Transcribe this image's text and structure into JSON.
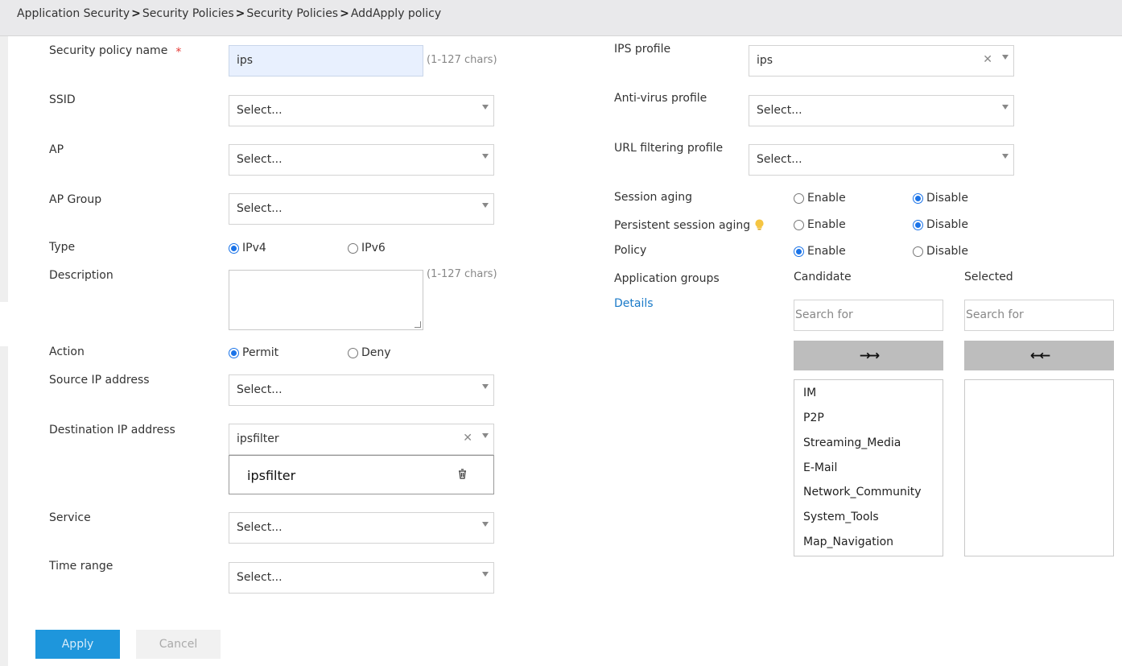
{
  "breadcrumb": [
    "Application Security",
    "Security Policies",
    "Security Policies",
    "AddApply policy"
  ],
  "left": {
    "policy_name_label": "Security policy name",
    "required_mark": "*",
    "policy_name_value": "ips",
    "policy_name_hint": "(1-127 chars)",
    "ssid_label": "SSID",
    "ssid_value": "Select...",
    "ap_label": "AP",
    "ap_value": "Select...",
    "ap_group_label": "AP Group",
    "ap_group_value": "Select...",
    "type_label": "Type",
    "type_ipv4": "IPv4",
    "type_ipv6": "IPv6",
    "description_label": "Description",
    "description_hint": "(1-127 chars)",
    "action_label": "Action",
    "action_permit": "Permit",
    "action_deny": "Deny",
    "source_ip_label": "Source IP address",
    "source_ip_value": "Select...",
    "dest_ip_label": "Destination IP address",
    "dest_ip_value": "ipsfilter",
    "dest_ip_chip": "ipsfilter",
    "service_label": "Service",
    "service_value": "Select...",
    "time_range_label": "Time range",
    "time_range_value": "Select..."
  },
  "right": {
    "ips_profile_label": "IPS profile",
    "ips_profile_value": "ips",
    "antivirus_label": "Anti-virus profile",
    "antivirus_value": "Select...",
    "url_filter_label": "URL filtering profile",
    "url_filter_value": "Select...",
    "session_aging_label": "Session aging",
    "persistent_aging_label": "Persistent session aging",
    "policy_label": "Policy",
    "enable": "Enable",
    "disable": "Disable",
    "app_groups_label": "Application groups",
    "details_link": "Details",
    "candidate_label": "Candidate",
    "selected_label": "Selected",
    "search_placeholder": "Search for",
    "move_right": "→→",
    "move_left": "←←",
    "candidate_items": [
      "IM",
      "P2P",
      "Streaming_Media",
      "E-Mail",
      "Network_Community",
      "System_Tools",
      "Map_Navigation"
    ]
  },
  "buttons": {
    "apply": "Apply",
    "cancel": "Cancel"
  },
  "colors": {
    "accent": "#1a73e8",
    "apply_bg": "#1e96dc",
    "link": "#1a7ac8",
    "required": "#e53935"
  }
}
